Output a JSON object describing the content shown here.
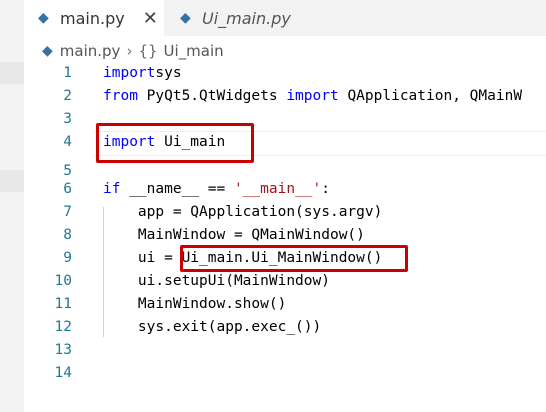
{
  "tabs": [
    {
      "label": "main.py",
      "close": "✕",
      "active": true
    },
    {
      "label": "Ui_main.py",
      "active": false
    }
  ],
  "breadcrumb": {
    "file": "main.py",
    "sep": "›",
    "brace": "{}",
    "symbol": "Ui_main"
  },
  "lines": [
    {
      "n": "1",
      "parts": [
        [
          "kw",
          "import"
        ],
        [
          "",
          "sys"
        ]
      ]
    },
    {
      "n": "2",
      "parts": [
        [
          "kw",
          "from"
        ],
        [
          "",
          " PyQt5.QtWidgets "
        ],
        [
          "kw",
          "import"
        ],
        [
          "",
          " QApplication, QMainW"
        ]
      ]
    },
    {
      "n": "3",
      "parts": []
    },
    {
      "n": "4",
      "parts": [
        [
          "kw",
          "import"
        ],
        [
          "",
          " Ui_main"
        ]
      ]
    },
    {
      "n": "5",
      "parts": []
    },
    {
      "n": "6",
      "parts": [
        [
          "kw",
          "if"
        ],
        [
          "",
          " __name__ == "
        ],
        [
          "str",
          "'__main__'"
        ],
        [
          "",
          ":"
        ]
      ]
    },
    {
      "n": "7",
      "parts": [
        [
          "",
          "    app = QApplication(sys.argv)"
        ]
      ]
    },
    {
      "n": "8",
      "parts": [
        [
          "",
          "    MainWindow = QMainWindow()"
        ]
      ]
    },
    {
      "n": "9",
      "parts": [
        [
          "",
          "    ui = Ui_main.Ui_MainWindow()"
        ]
      ]
    },
    {
      "n": "10",
      "parts": [
        [
          "",
          "    ui.setupUi(MainWindow)"
        ]
      ]
    },
    {
      "n": "11",
      "parts": [
        [
          "",
          "    MainWindow.show()"
        ]
      ]
    },
    {
      "n": "12",
      "parts": [
        [
          "",
          "    sys.exit(app.exec_())"
        ]
      ]
    },
    {
      "n": "13",
      "parts": []
    },
    {
      "n": "14",
      "parts": []
    }
  ],
  "colors": {
    "highlight_box": "#cc0000",
    "keyword": "#0000ff",
    "string": "#a31515",
    "line_number": "#237893"
  }
}
